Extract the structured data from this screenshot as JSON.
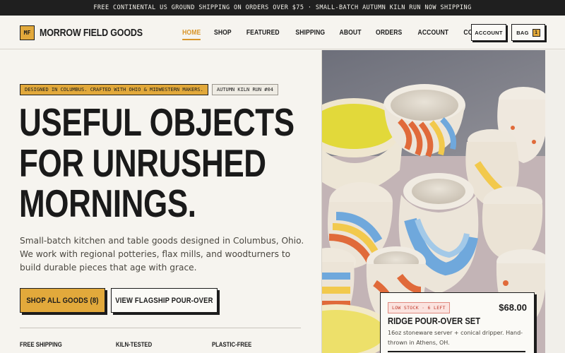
{
  "promo": {
    "text": "FREE CONTINENTAL US GROUND SHIPPING ON ORDERS OVER $75 · SMALL-BATCH AUTUMN KILN RUN NOW SHIPPING"
  },
  "header": {
    "logo_mark": "MF",
    "brand": "MORROW FIELD GOODS",
    "nav": [
      {
        "label": "HOME",
        "active": true
      },
      {
        "label": "SHOP"
      },
      {
        "label": "FEATURED"
      },
      {
        "label": "SHIPPING"
      },
      {
        "label": "ABOUT"
      },
      {
        "label": "ORDERS"
      },
      {
        "label": "ACCOUNT"
      },
      {
        "label": "CONTACT"
      }
    ],
    "account_label": "ACCOUNT",
    "bag_label": "BAG",
    "bag_count": "1"
  },
  "hero": {
    "badge_primary": "DESIGNED IN COLUMBUS. CRAFTED WITH OHIO & MIDWESTERN MAKERS.",
    "badge_secondary": "AUTUMN KILN RUN #04",
    "headline": [
      "USEFUL OBJECTS",
      "FOR UNRUSHED",
      "MORNINGS."
    ],
    "lede": "Small-batch kitchen and table goods designed in Columbus, Ohio. We work with regional potteries, flax mills, and woodturners to build durable pieces that age with grace.",
    "cta_primary": "SHOP ALL GOODS (8)",
    "cta_secondary": "VIEW FLAGSHIP POUR-OVER",
    "features": [
      "FREE SHIPPING",
      "KILN-TESTED",
      "PLASTIC-FREE"
    ]
  },
  "product": {
    "stock": "LOW STOCK · 6 LEFT",
    "price": "$68.00",
    "name": "RIDGE POUR-OVER SET",
    "description": "16oz stoneware server + conical dripper. Hand-thrown in Athens, OH."
  },
  "colors": {
    "accent": "#e2a93b",
    "ink": "#1c1c1c",
    "paper": "#f6f4ef",
    "stock_red": "#c0392b"
  }
}
